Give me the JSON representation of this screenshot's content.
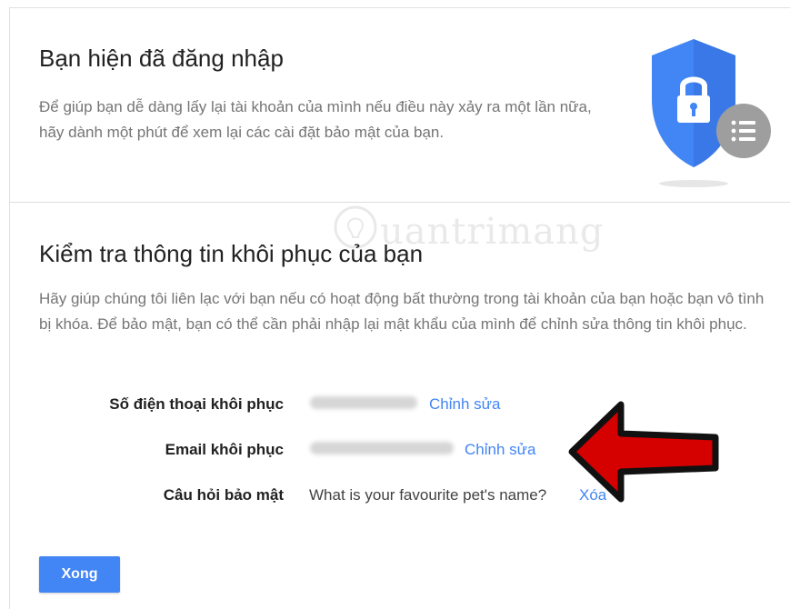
{
  "header": {
    "title": "Bạn hiện đã đăng nhập",
    "description": "Để giúp bạn dễ dàng lấy lại tài khoản của mình nếu điều này xảy ra một lần nữa, hãy dành một phút để xem lại các cài đặt bảo mật của bạn.",
    "icon": "shield-lock-icon"
  },
  "watermark": {
    "text": "uantrimang",
    "icon": "bulb-icon"
  },
  "recovery": {
    "title": "Kiểm tra thông tin khôi phục của bạn",
    "description": "Hãy giúp chúng tôi liên lạc với bạn nếu có hoạt động bất thường trong tài khoản của bạn hoặc bạn vô tình bị khóa. Để bảo mật, bạn có thể cần phải nhập lại mật khẩu của mình để chỉnh sửa thông tin khôi phục.",
    "rows": [
      {
        "label": "Số điện thoại khôi phục",
        "value": "",
        "action": "Chỉnh sửa"
      },
      {
        "label": "Email khôi phục",
        "value": "",
        "action": "Chỉnh sửa"
      },
      {
        "label": "Câu hỏi bảo mật",
        "value": "What is your favourite pet's name?",
        "action": "Xóa"
      }
    ]
  },
  "footer": {
    "done_label": "Xong"
  },
  "colors": {
    "accent": "#4285f4",
    "arrow": "#d50000",
    "shield": "#4285f4"
  }
}
